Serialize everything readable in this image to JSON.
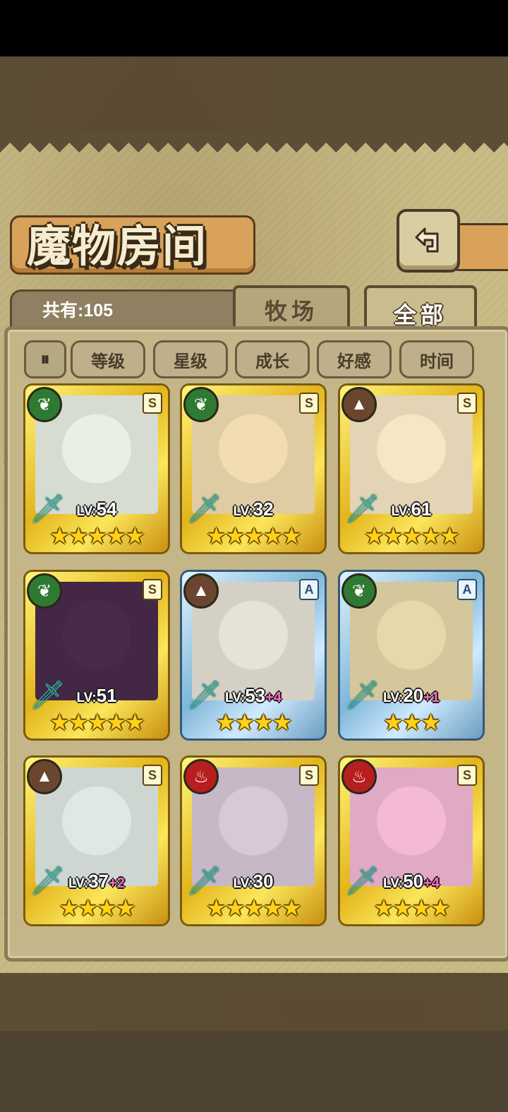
{
  "header": {
    "title": "魔物房间",
    "back_icon": "back-arrow-icon"
  },
  "count_label": "共有:105",
  "tabs": [
    {
      "label": "牧场",
      "active": false
    },
    {
      "label": "全部",
      "active": true
    }
  ],
  "sort": {
    "toggle_icon": "sort-toggle-icon",
    "toggle_glyph": "⏸",
    "buttons": [
      "等级",
      "星级",
      "成长",
      "好感",
      "时间"
    ]
  },
  "monsters": [
    {
      "element": "leaf",
      "element_glyph": "❦",
      "rank": "S",
      "frame": "gold",
      "level_prefix": "LV:",
      "level": "54",
      "plus": "",
      "stars": "★★★★★",
      "star_count": 5,
      "portrait_color": "#e9efe4"
    },
    {
      "element": "leaf",
      "element_glyph": "❦",
      "rank": "S",
      "frame": "gold",
      "level_prefix": "LV:",
      "level": "32",
      "plus": "",
      "stars": "★★★★★",
      "star_count": 5,
      "portrait_color": "#f2ddb0"
    },
    {
      "element": "earth",
      "element_glyph": "▲",
      "rank": "S",
      "frame": "gold",
      "level_prefix": "LV:",
      "level": "61",
      "plus": "",
      "stars": "★★★★★",
      "star_count": 5,
      "portrait_color": "#f5e6c4"
    },
    {
      "element": "leaf",
      "element_glyph": "❦",
      "rank": "S",
      "frame": "gold",
      "level_prefix": "LV:",
      "level": "51",
      "plus": "",
      "stars": "★★★★★",
      "star_count": 5,
      "portrait_color": "#4a2a4a"
    },
    {
      "element": "earth",
      "element_glyph": "▲",
      "rank": "A",
      "frame": "blue",
      "level_prefix": "LV:",
      "level": "53",
      "plus": "+4",
      "stars": "★★★★",
      "star_count": 4,
      "portrait_color": "#e6e2d6"
    },
    {
      "element": "leaf",
      "element_glyph": "❦",
      "rank": "A",
      "frame": "blue",
      "level_prefix": "LV:",
      "level": "20",
      "plus": "+1",
      "stars": "★★★",
      "star_count": 3,
      "portrait_color": "#e6d8a8"
    },
    {
      "element": "earth",
      "element_glyph": "▲",
      "rank": "S",
      "frame": "gold",
      "level_prefix": "LV:",
      "level": "37",
      "plus": "+2",
      "stars": "★★★★",
      "star_count": 4,
      "portrait_color": "#dfe8e4"
    },
    {
      "element": "fire",
      "element_glyph": "♨",
      "rank": "S",
      "frame": "gold",
      "level_prefix": "LV:",
      "level": "30",
      "plus": "",
      "stars": "★★★★★",
      "star_count": 5,
      "portrait_color": "#d8c8d8"
    },
    {
      "element": "fire",
      "element_glyph": "♨",
      "rank": "S",
      "frame": "gold",
      "level_prefix": "LV:",
      "level": "50",
      "plus": "+4",
      "stars": "★★★★",
      "star_count": 4,
      "portrait_color": "#f3b9d6"
    }
  ]
}
